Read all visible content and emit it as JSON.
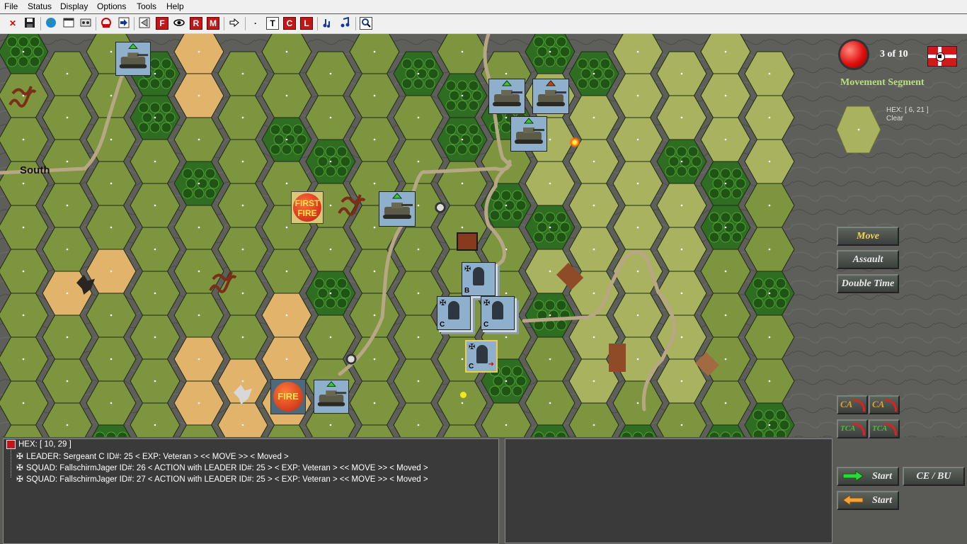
{
  "menu": {
    "items": [
      "File",
      "Status",
      "Display",
      "Options",
      "Tools",
      "Help"
    ]
  },
  "toolbar": {
    "t_label": "T",
    "c_label": "C",
    "l_label": "L",
    "f_label": "F",
    "r_label": "R",
    "m_label": "M"
  },
  "status": {
    "turn_text": "3 of 10",
    "phase": "Movement Segment",
    "hex_label": "HEX: [ 6, 21 ]",
    "terrain": "Clear"
  },
  "map": {
    "south_label": "South",
    "first_fire_line1": "FIRST",
    "first_fire_line2": "FIRE",
    "fire_label": "FIRE",
    "unit_letters": [
      "B",
      "C",
      "C",
      "C"
    ]
  },
  "buttons": {
    "move": "Move",
    "assault": "Assault",
    "double_time": "Double Time",
    "ca1": "CA",
    "ca2": "CA",
    "tca1": "TCA",
    "tca2": "TCA",
    "start_forward": "Start",
    "ce_bu": "CE / BU",
    "start_back": "Start"
  },
  "info": {
    "hex_line": "HEX: [ 10, 29 ]",
    "lines": [
      "LEADER: Sergeant C   ID#: 25 < EXP: Veteran >   << MOVE >>   < Moved >",
      "SQUAD: FallschirmJager   ID#: 26  < ACTION with LEADER ID#: 25 >  < EXP: Veteran >   << MOVE >>   < Moved >",
      "SQUAD: FallschirmJager   ID#: 27  < ACTION with LEADER ID#: 25 >  < EXP: Veteran >   << MOVE >>   < Moved >"
    ]
  },
  "colors": {
    "grass": "#7d953e",
    "light_grass": "#a9b25e",
    "wheat": "#e2b36a",
    "forest": "#2f6e22",
    "road": "#b6a684",
    "counter": "#8eb0cc",
    "turn_red": "#e01010",
    "phase_green": "#b7e07a"
  }
}
